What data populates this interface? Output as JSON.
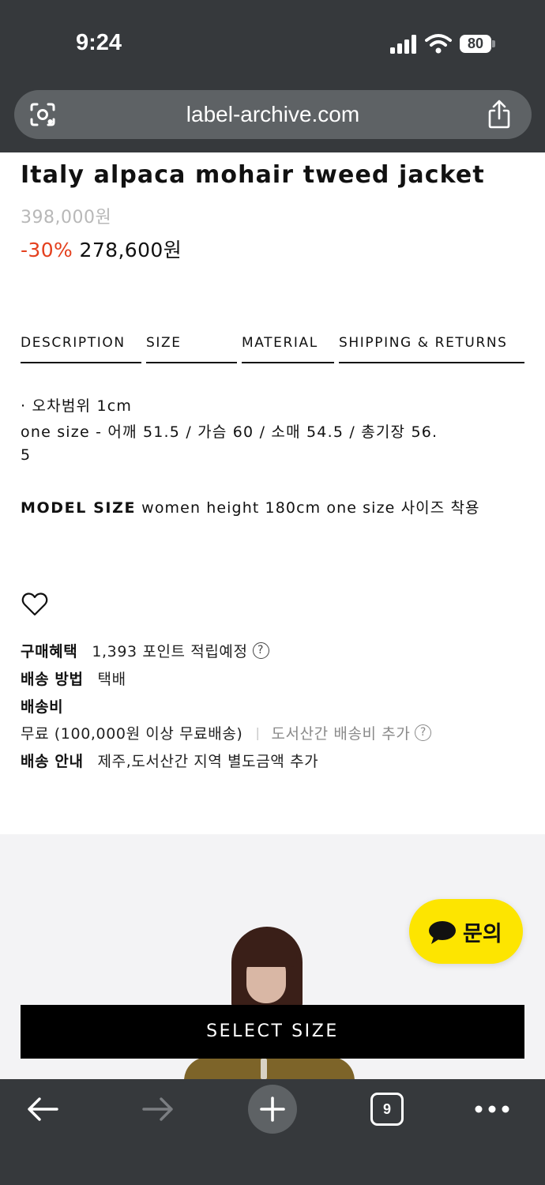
{
  "status_bar": {
    "time": "9:24",
    "battery": "80"
  },
  "browser": {
    "url": "label-archive.com",
    "tab_count": "9"
  },
  "product": {
    "title": "Italy alpaca mohair tweed jacket",
    "original_price": "398,000원",
    "discount": "-30%",
    "sale_price": "278,600원"
  },
  "tabs": [
    {
      "label": "DESCRIPTION"
    },
    {
      "label": "SIZE"
    },
    {
      "label": "MATERIAL"
    },
    {
      "label": "SHIPPING & RETURNS"
    }
  ],
  "size_info": {
    "tolerance": "· 오차범위 1cm",
    "measurements_line1": "one size  -  어깨  51.5  /  가슴  60  /  소매  54.5  /  총기장  56.",
    "measurements_line2": "5",
    "model_size_label": "MODEL SIZE",
    "model_size_text": " women height 180cm one size 사이즈 착용"
  },
  "purchase_info": {
    "benefit_label": "구매혜택",
    "benefit_value": "1,393 포인트 적립예정",
    "delivery_method_label": "배송 방법",
    "delivery_method_value": "택배",
    "shipping_fee_label": "배송비",
    "shipping_fee_value": "무료 (100,000원 이상 무료배송)",
    "separator": "|",
    "island_fee": "도서산간 배송비 추가",
    "shipping_notice_label": "배송 안내",
    "shipping_notice_value": "제주,도서산간 지역 별도금액 추가"
  },
  "inquiry_button": {
    "label": "문의",
    "color": "#fde500"
  },
  "select_size_button": {
    "label": "SELECT SIZE"
  },
  "colors": {
    "discount": "#e4401e",
    "chrome": "#36393c",
    "url_bar": "#5e6265"
  }
}
